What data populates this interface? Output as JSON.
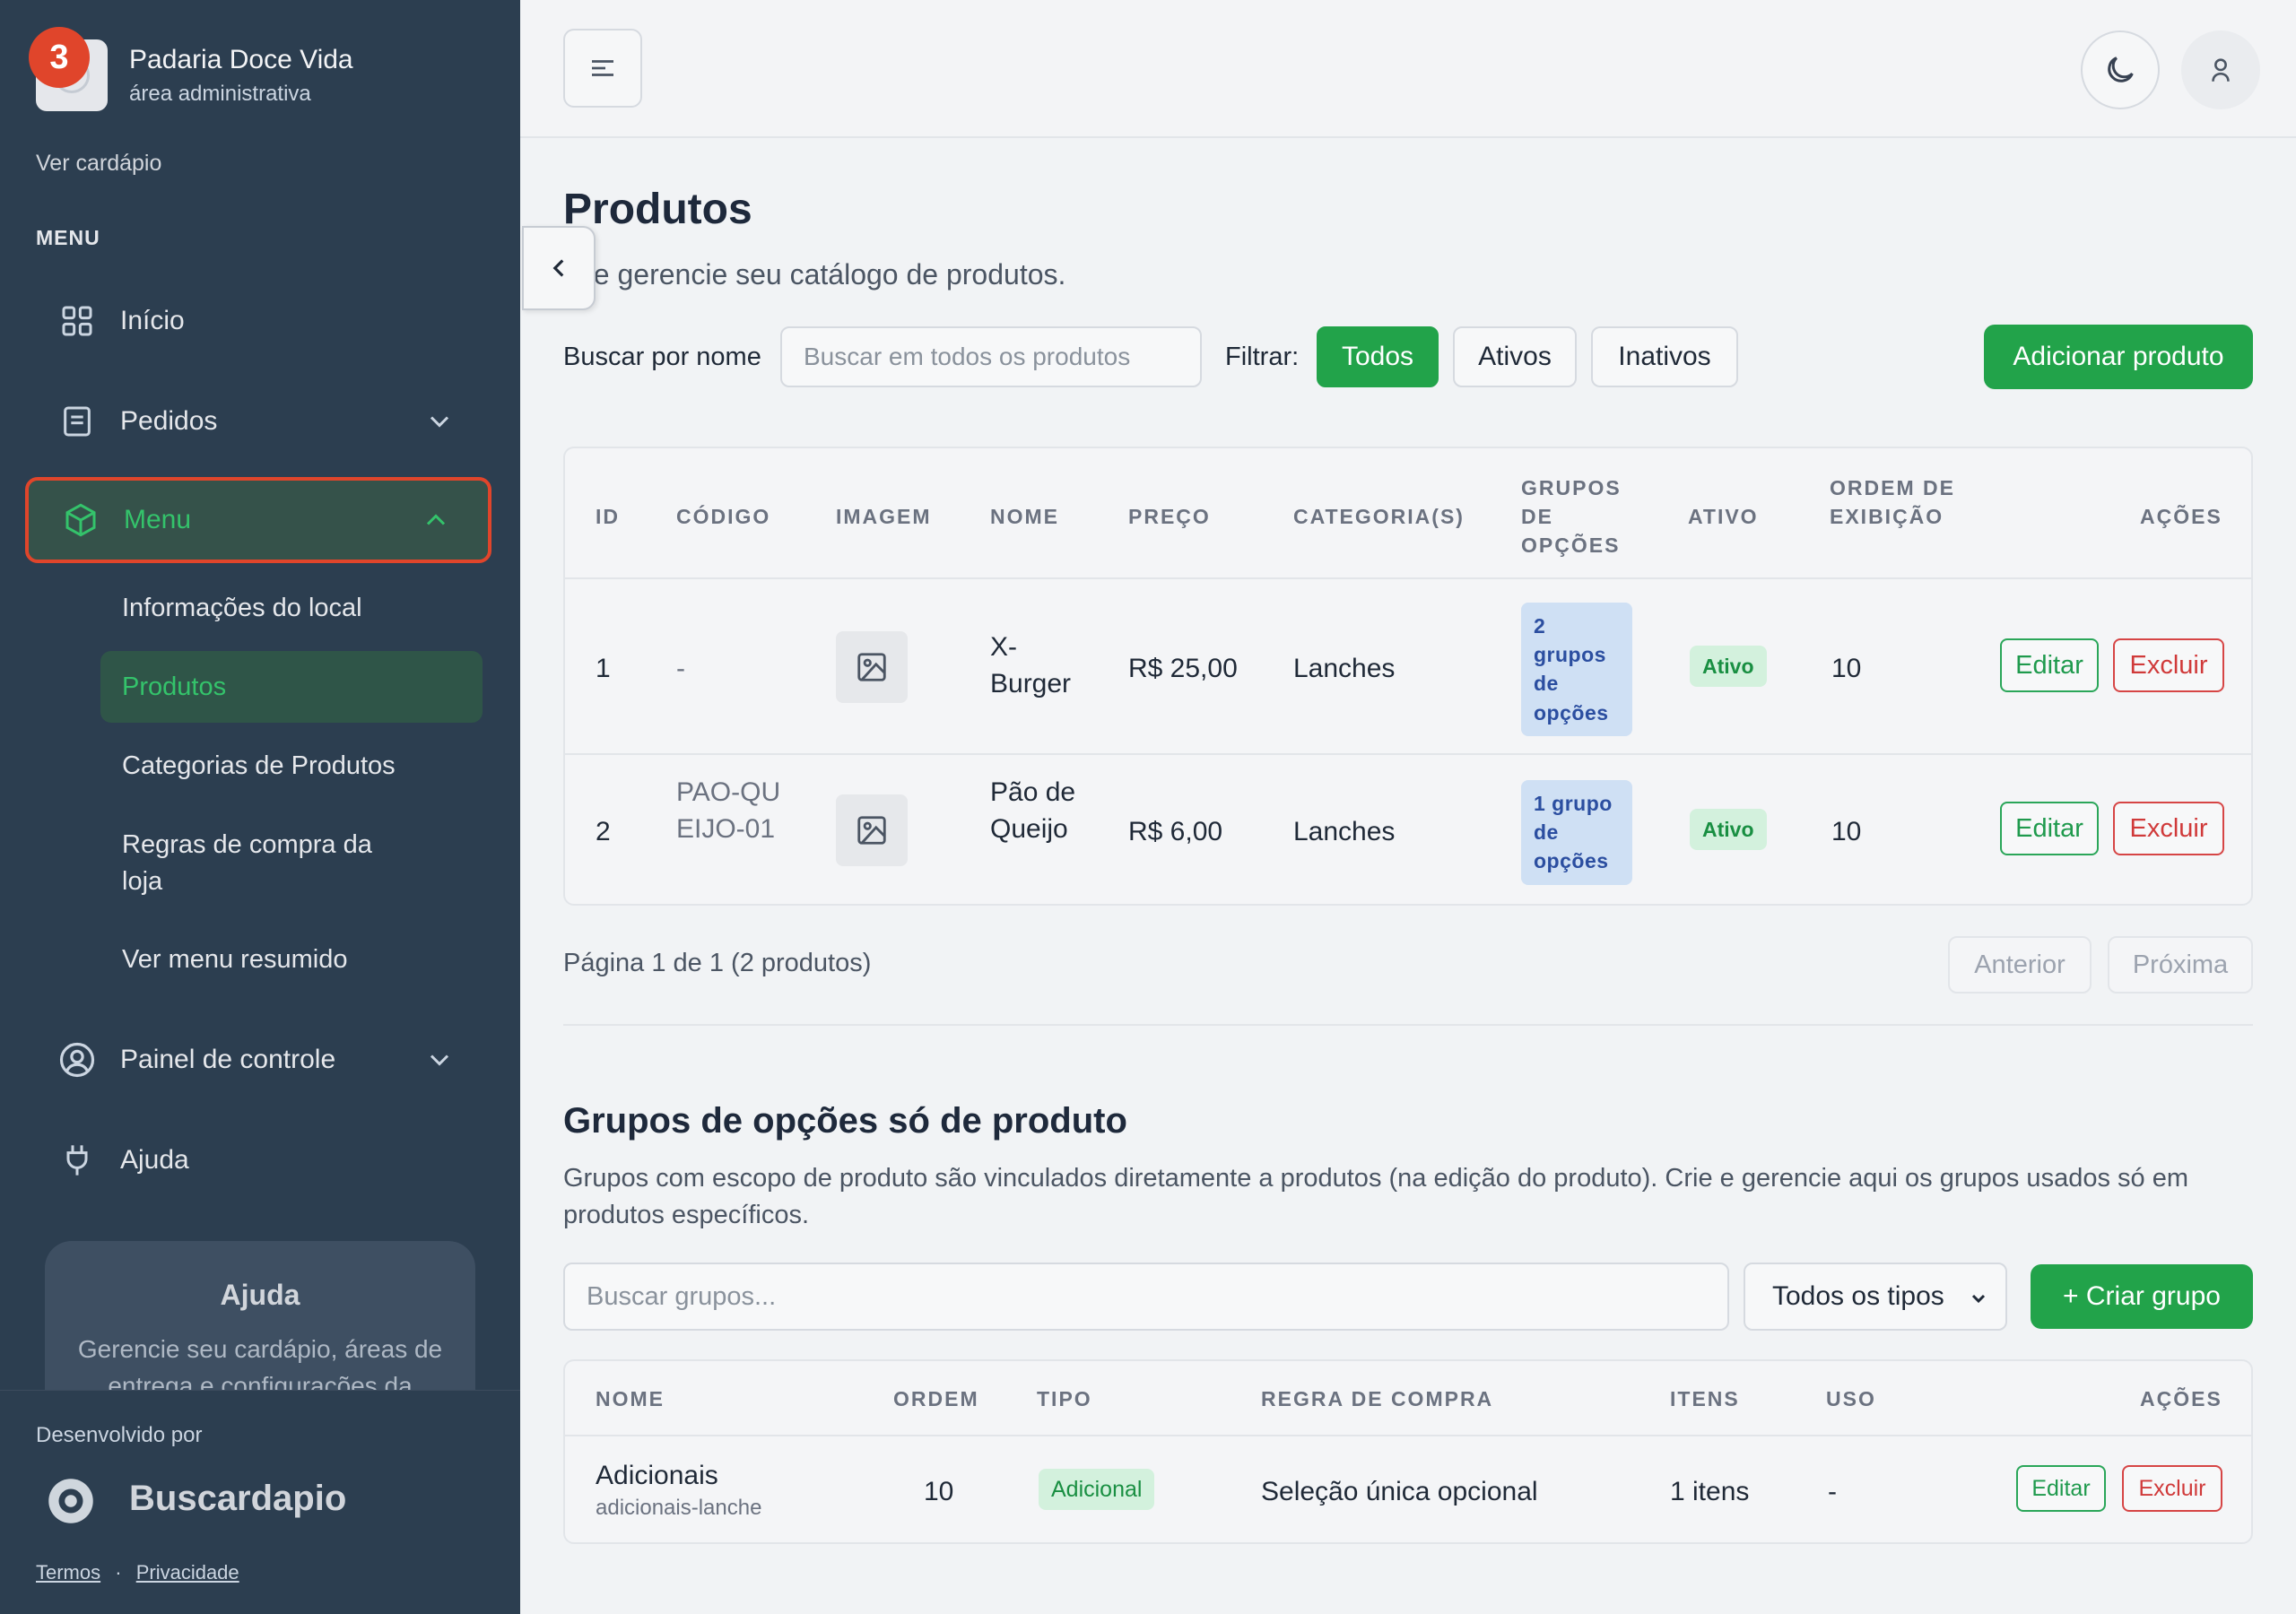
{
  "brand": {
    "name": "Padaria Doce Vida",
    "subtitle": "área administrativa",
    "notification_count": "3"
  },
  "sidebar": {
    "view_menu_link": "Ver cardápio",
    "menu_heading": "MENU",
    "items": {
      "inicio": "Início",
      "pedidos": "Pedidos",
      "menu": "Menu",
      "painel": "Painel de controle",
      "ajuda": "Ajuda"
    },
    "submenu": {
      "info_local": "Informações do local",
      "produtos": "Produtos",
      "categorias": "Categorias de Produtos",
      "regras": "Regras de compra da loja",
      "menu_resumido": "Ver menu resumido"
    },
    "help_card": {
      "title": "Ajuda",
      "text": "Gerencie seu cardápio, áreas de entrega e configurações da"
    },
    "footer": {
      "developed_by": "Desenvolvido por",
      "brand": "Buscardapio",
      "terms": "Termos",
      "separator": "·",
      "privacy": "Privacidade"
    }
  },
  "page": {
    "title": "Produtos",
    "subtitle": "ie e gerencie seu catálogo de produtos."
  },
  "filters": {
    "search_label": "Buscar por nome",
    "search_placeholder": "Buscar em todos os produtos",
    "filter_label": "Filtrar:",
    "options": {
      "todos": "Todos",
      "ativos": "Ativos",
      "inativos": "Inativos"
    },
    "selected": "Todos",
    "add_button": "Adicionar produto"
  },
  "products_table": {
    "headers": {
      "id": "ID",
      "codigo": "CÓDIGO",
      "imagem": "IMAGEM",
      "nome": "NOME",
      "preco": "PREÇO",
      "categorias": "CATEGORIA(S)",
      "grupos": "GRUPOS DE OPÇÕES",
      "ativo": "ATIVO",
      "ordem": "ORDEM DE EXIBIÇÃO",
      "acoes": "AÇÕES"
    },
    "rows": [
      {
        "id": "1",
        "codigo": "-",
        "nome": "X-Burger",
        "preco": "R$ 25,00",
        "categoria": "Lanches",
        "grupos": "2 grupos de opções",
        "ativo": "Ativo",
        "ordem": "10",
        "edit": "Editar",
        "delete": "Excluir"
      },
      {
        "id": "2",
        "codigo": "PAO-QUEIJO-01",
        "nome": "Pão de Queijo",
        "preco": "R$ 6,00",
        "categoria": "Lanches",
        "grupos": "1 grupo de opções",
        "ativo": "Ativo",
        "ordem": "10",
        "edit": "Editar",
        "delete": "Excluir"
      }
    ]
  },
  "pagination": {
    "text": "Página 1 de 1 (2 produtos)",
    "prev": "Anterior",
    "next": "Próxima"
  },
  "option_groups": {
    "title": "Grupos de opções só de produto",
    "description": "Grupos com escopo de produto são vinculados diretamente a produtos (na edição do produto). Crie e gerencie aqui os grupos usados só em produtos específicos.",
    "search_placeholder": "Buscar grupos...",
    "type_select": "Todos os tipos",
    "create_button": "+ Criar grupo",
    "headers": {
      "nome": "NOME",
      "ordem": "ORDEM",
      "tipo": "TIPO",
      "regra": "REGRA DE COMPRA",
      "itens": "ITENS",
      "uso": "USO",
      "acoes": "AÇÕES"
    },
    "rows": [
      {
        "nome": "Adicionais",
        "slug": "adicionais-lanche",
        "ordem": "10",
        "tipo": "Adicional",
        "regra": "Seleção única opcional",
        "itens": "1 itens",
        "uso": "-",
        "edit": "Editar",
        "delete": "Excluir"
      }
    ]
  },
  "colors": {
    "sidebar_bg": "#2c3e50",
    "accent_green": "#22a34a",
    "active_text": "#34c36b",
    "highlight_border": "#e0452b",
    "danger": "#d03a3a"
  }
}
